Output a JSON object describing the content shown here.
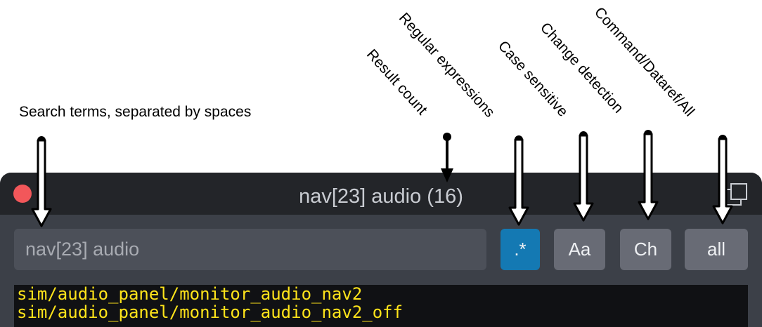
{
  "annotations": {
    "search_terms": "Search terms, separated by spaces",
    "result_count": "Result count",
    "regular_expressions": "Regular expressions",
    "case_sensitive": "Case sensitive",
    "change_detection": "Change detection",
    "command_dataref_all": "Command/Dataref/All"
  },
  "window": {
    "title": "nav[23] audio (16)",
    "close_color": "#f2575a",
    "popout_icon": "popout-window-icon"
  },
  "search": {
    "value": "nav[23] audio",
    "placeholder": ""
  },
  "toolbar": {
    "regex_label": ".*",
    "regex_active": true,
    "case_label": "Aa",
    "case_active": false,
    "change_label": "Ch",
    "change_active": false,
    "filter_label": "all",
    "accent_color": "#1479b3"
  },
  "results": [
    "sim/audio_panel/monitor_audio_nav2",
    "sim/audio_panel/monitor_audio_nav2_off"
  ]
}
